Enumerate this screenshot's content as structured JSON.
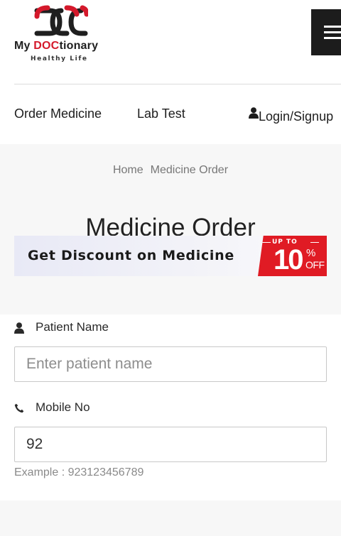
{
  "brand": {
    "name_prefix": "My ",
    "name_highlight": "DOC",
    "name_suffix": "tionary",
    "tagline": "Healthy Life",
    "colors": {
      "red": "#d4192b",
      "dark": "#1f1f1f"
    }
  },
  "header": {
    "menu_icon": "hamburger-icon"
  },
  "nav": {
    "order_medicine": "Order Medicine",
    "lab_test": "Lab Test",
    "login": "Login/Signup",
    "login_icon": "user-icon"
  },
  "breadcrumb": {
    "home": "Home",
    "current": "Medicine Order"
  },
  "page": {
    "title": "Medicine Order"
  },
  "banner": {
    "text": "Get Discount on Medicine",
    "badge_upto": "UP TO",
    "badge_value": "10",
    "badge_percent": "%",
    "badge_off": "OFF",
    "badge_color": "#e01b24"
  },
  "form": {
    "patient_label": "Patient Name",
    "patient_icon": "user-icon",
    "patient_placeholder": "Enter patient name",
    "mobile_label": "Mobile No",
    "mobile_icon": "phone-icon",
    "mobile_value": "92",
    "mobile_hint": "Example : 923123456789"
  }
}
